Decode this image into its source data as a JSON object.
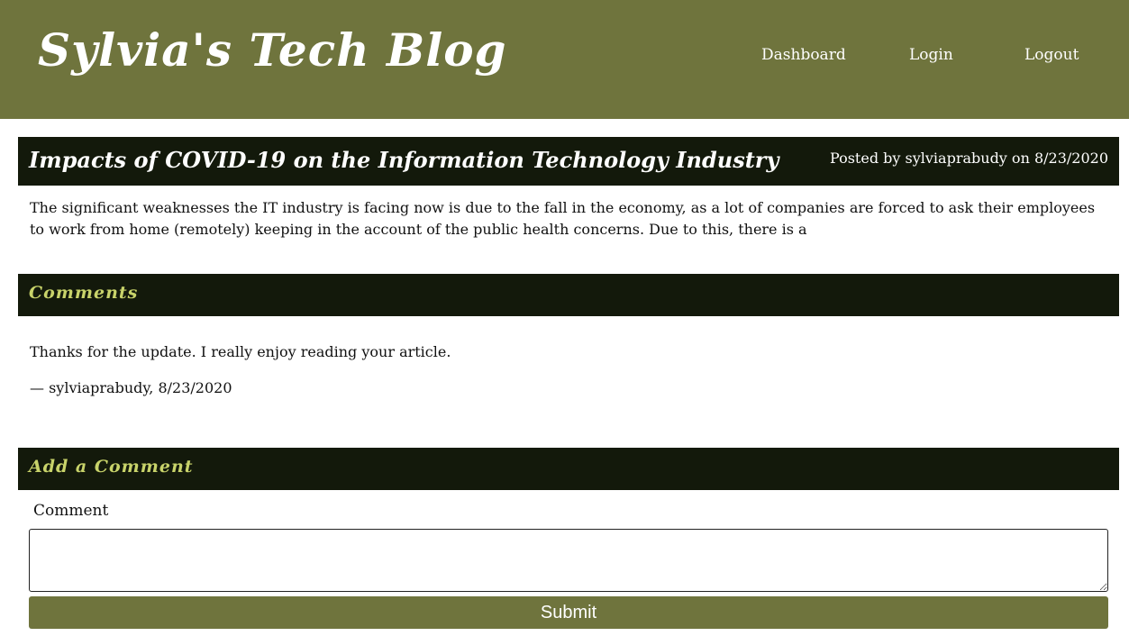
{
  "header": {
    "site_title": "Sylvia's Tech Blog",
    "nav": {
      "dashboard": "Dashboard",
      "login": "Login",
      "logout": "Logout"
    }
  },
  "post": {
    "title": "Impacts of COVID-19 on the Information Technology Industry",
    "meta": "Posted by sylviaprabudy on 8/23/2020",
    "body": "The significant weaknesses the IT industry is facing now is due to the fall in the economy, as a lot of companies are forced to ask their employees to work from home (remotely) keeping in the account of the public health concerns. Due to this, there is a"
  },
  "comments": {
    "heading": "Comments",
    "items": [
      {
        "text": "Thanks for the update. I really enjoy reading your article.",
        "attribution": "— sylviaprabudy, 8/23/2020"
      }
    ]
  },
  "add_comment": {
    "heading": "Add a Comment",
    "label": "Comment",
    "input_value": "",
    "submit_label": "Submit"
  },
  "colors": {
    "header_bg": "#6f743d",
    "bar_bg": "#13190b",
    "section_heading": "#c8d36a",
    "button_bg": "#6f743d"
  }
}
